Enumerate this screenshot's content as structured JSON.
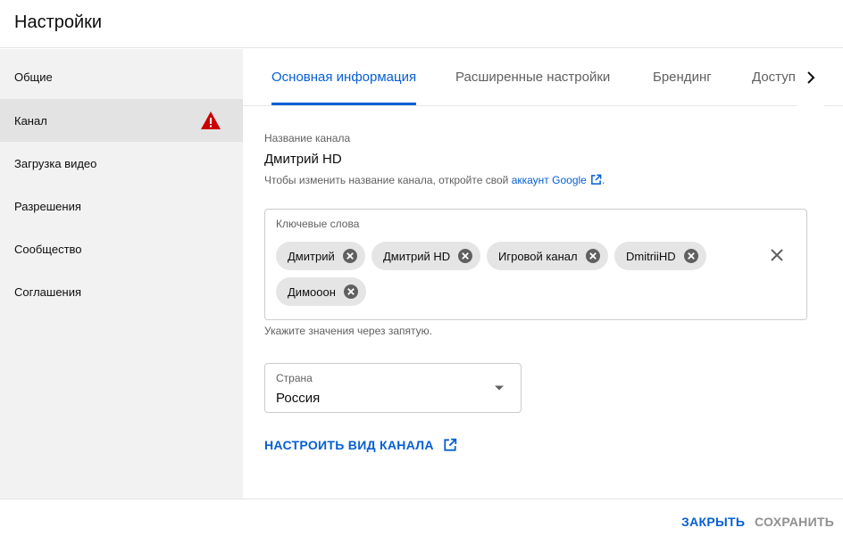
{
  "header": {
    "title": "Настройки"
  },
  "sidebar": {
    "items": [
      {
        "label": "Общие"
      },
      {
        "label": "Канал",
        "warning": true
      },
      {
        "label": "Загрузка видео"
      },
      {
        "label": "Разрешения"
      },
      {
        "label": "Сообщество"
      },
      {
        "label": "Соглашения"
      }
    ],
    "active": "Канал"
  },
  "tabs": {
    "items": [
      {
        "label": "Основная информация"
      },
      {
        "label": "Расширенные настройки"
      },
      {
        "label": "Брендинг"
      },
      {
        "label": "Доступ"
      }
    ],
    "active": "Основная информация"
  },
  "channel_name": {
    "label": "Название канала",
    "value": "Дмитрий HD",
    "hint_prefix": "Чтобы изменить название канала, откройте свой",
    "hint_link": "аккаунт Google",
    "hint_suffix": "."
  },
  "keywords": {
    "label": "Ключевые слова",
    "chips": [
      "Дмитрий",
      "Дмитрий HD",
      "Игровой канал",
      "DmitriiHD",
      "Димооон"
    ],
    "hint": "Укажите значения через запятую."
  },
  "country": {
    "label": "Страна",
    "value": "Россия"
  },
  "customize_link": "НАСТРОИТЬ ВИД КАНАЛА",
  "footer": {
    "close_label": "ЗАКРЫТЬ",
    "save_label": "СОХРАНИТЬ"
  },
  "colors": {
    "accent": "#065fd4",
    "warning": "#cc0000",
    "sidebar_bg": "#f2f2f2",
    "sidebar_active_bg": "#e3e3e3",
    "chip_bg": "#e5e5e5",
    "disabled_text": "#909090"
  }
}
